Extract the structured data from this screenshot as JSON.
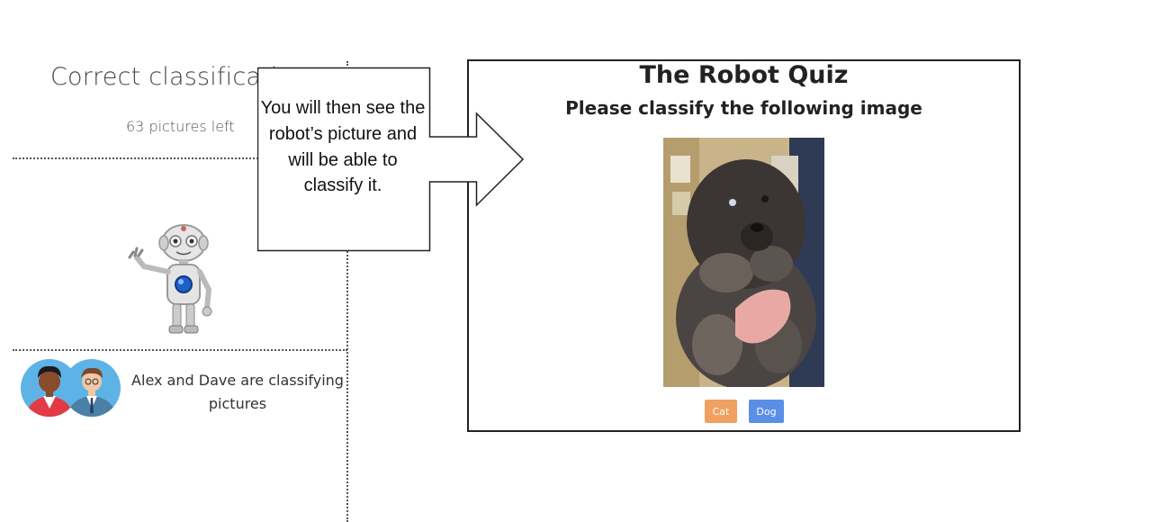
{
  "score": {
    "title": "Correct classification",
    "pictures_left": "63 pictures left"
  },
  "players": {
    "text": "Alex and Dave are classifying pictures"
  },
  "callout": {
    "text": "You will then see the robot’s picture and will be able to classify it."
  },
  "quiz": {
    "title": "The Robot Quiz",
    "subtitle": "Please classify the following image",
    "buttons": [
      {
        "label": "Cat",
        "color": "#f0a060"
      },
      {
        "label": "Dog",
        "color": "#5b8fe6"
      }
    ]
  },
  "icons": [
    "robot-icon",
    "alex-avatar-icon",
    "dave-avatar-icon"
  ]
}
